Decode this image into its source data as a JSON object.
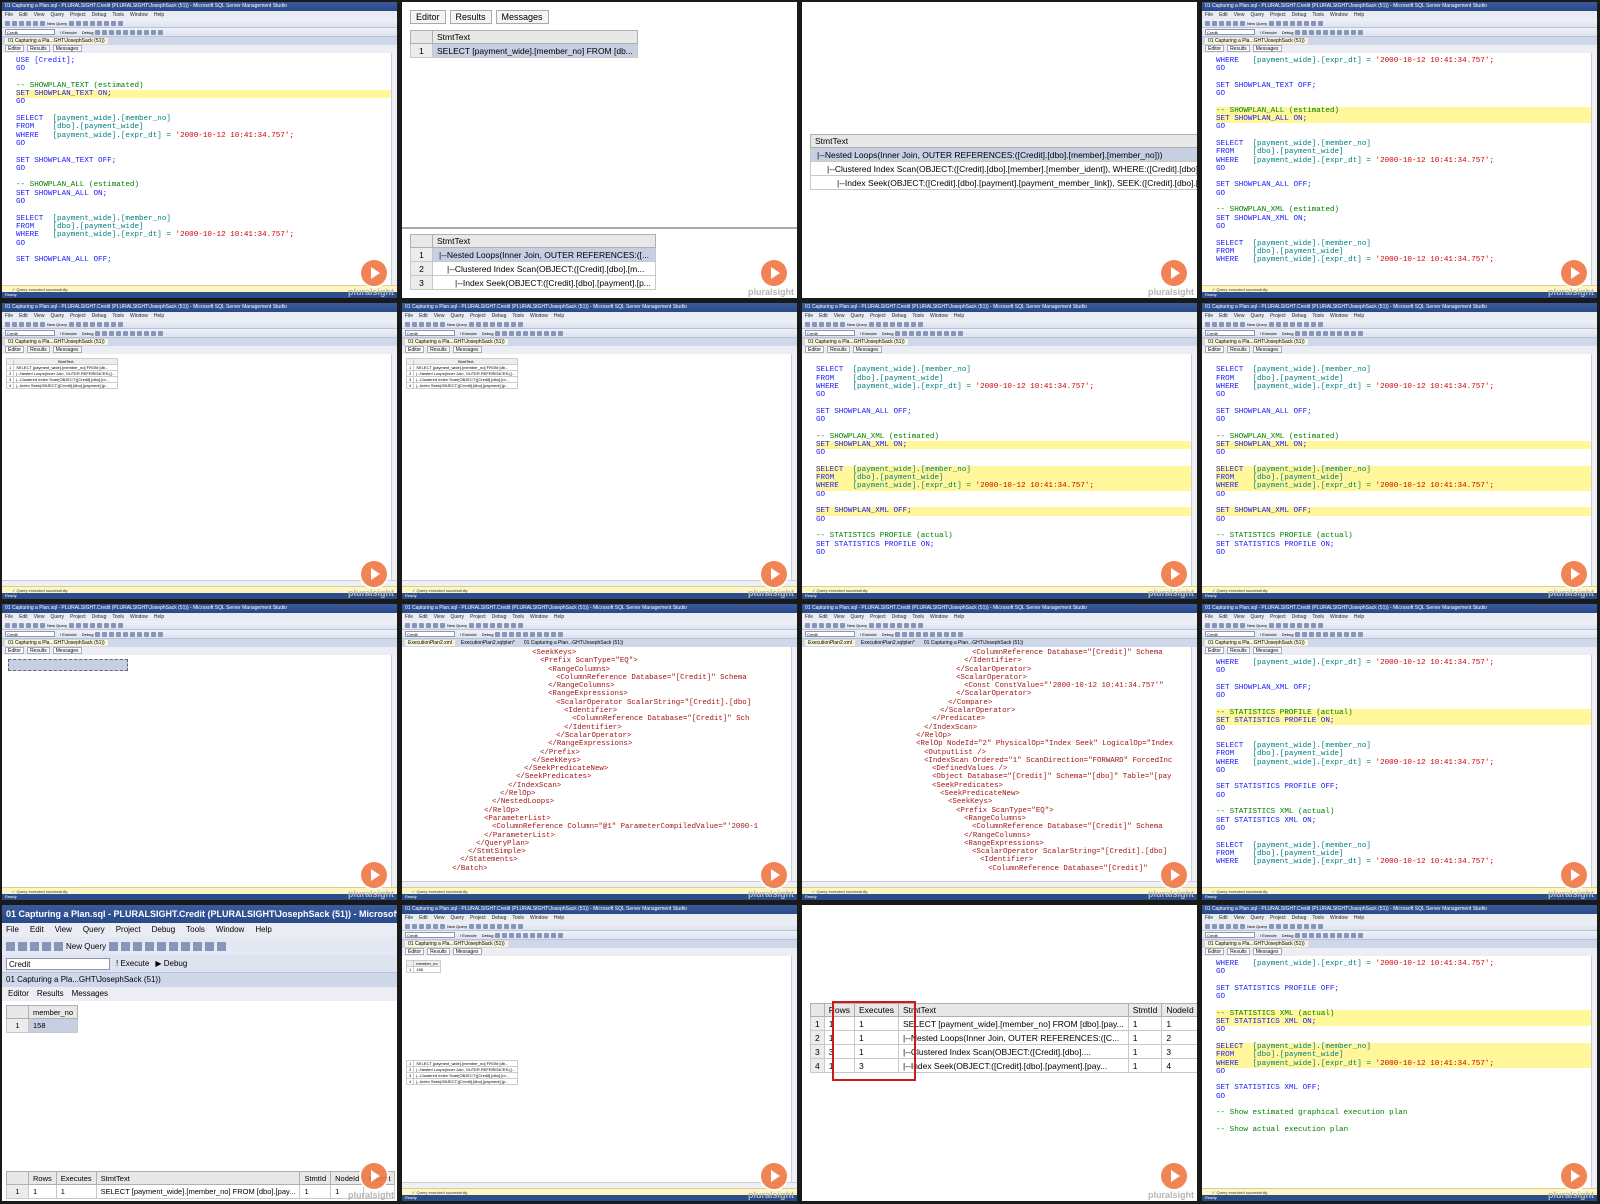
{
  "window": {
    "title": "01 Capturing a Plan.sql - PLURALSIGHT.Credit (PLURALSIGHT\\JosephSack (51)) - Microsoft SQL Server Management Studio",
    "menu": [
      "File",
      "Edit",
      "View",
      "Query",
      "Project",
      "Debug",
      "Tools",
      "Window",
      "Help"
    ],
    "database": "Credit",
    "new_query": "New Query",
    "execute": "Execute",
    "debug": "Debug",
    "doc_tab": "01 Capturing a Pla...GHT\\JosephSack (51))",
    "status": "Query executed successfully.",
    "ready": "Ready",
    "brand": "pluralsight"
  },
  "tabs": {
    "editor": "Editor",
    "results": "Results",
    "messages": "Messages"
  },
  "xml_tabs": [
    "ExecutionPlan2.xml",
    "ExecutionPlan2.sqlplan*",
    "01 Capturing a Plan...GHT\\JosephSack (51))"
  ],
  "results": {
    "stmt_header": "StmtText",
    "select_stmt": "SELECT [payment_wide].[member_no]  FROM   [db...",
    "plan_short": [
      "|--Nested Loops(Inner Join, OUTER REFERENCES:([...",
      "|--Clustered Index Scan(OBJECT:([Credit].[dbo].[m...",
      "|--Index Seek(OBJECT:([Credit].[dbo].[payment].[p..."
    ],
    "plan_long": [
      "|--Nested Loops(Inner Join, OUTER REFERENCES:([Credit].[dbo].[member].[member_no]))",
      "|--Clustered Index Scan(OBJECT:([Credit].[dbo].[member].[member_ident]), WHERE:([Credit].[dbo].[me",
      "|--Index Seek(OBJECT:([Credit].[dbo].[payment].[payment_member_link]), SEEK:([Credit].[dbo].[payme"
    ],
    "member_no_header": "member_no",
    "member_no_value": "158",
    "profile_headers": [
      "Rows",
      "Executes",
      "StmtText",
      "StmtId",
      "NodeId"
    ],
    "profile_rows": [
      [
        "1",
        "1",
        "1",
        "SELECT [payment_wide].[member_no] FROM [dbo].[pay...",
        "1",
        "1"
      ],
      [
        "2",
        "1",
        "1",
        "|--Nested Loops(Inner Join, OUTER REFERENCES:([C...",
        "1",
        "2"
      ],
      [
        "3",
        "3",
        "1",
        "|--Clustered Index Scan(OBJECT:([Credit].[dbo]....",
        "1",
        "3"
      ],
      [
        "4",
        "1",
        "3",
        "|--Index Seek(OBJECT:([Credit].[dbo].[payment].[pay...",
        "1",
        "4"
      ]
    ],
    "profile_row_single": [
      "1",
      "1",
      "1",
      "SELECT [payment_wide].[member_no] FROM [dbo].[pay...",
      "1",
      "1"
    ],
    "profile_headers_short": [
      "Rows",
      "Executes",
      "StmtText",
      "StmtId",
      "NodeId",
      "Parent"
    ]
  },
  "code_lines": {
    "use": "USE [Credit];",
    "go": "GO",
    "c_text": "-- SHOWPLAN_TEXT (estimated)",
    "set_text_on": "SET SHOWPLAN_TEXT ON;",
    "set_text_off": "SET SHOWPLAN_TEXT OFF;",
    "c_all": "-- SHOWPLAN_ALL (estimated)",
    "set_all_on": "SET SHOWPLAN_ALL ON;",
    "set_all_off": "SET SHOWPLAN_ALL OFF;",
    "c_xml": "-- SHOWPLAN_XML (estimated)",
    "set_xml_on": "SET SHOWPLAN_XML ON;",
    "set_xml_off": "SET SHOWPLAN_XML OFF;",
    "c_profile": "-- STATISTICS PROFILE (actual)",
    "set_profile_on": "SET STATISTICS PROFILE ON;",
    "set_profile_off": "SET STATISTICS PROFILE OFF;",
    "c_stxml": "-- STATISTICS XML (actual)",
    "set_stxml_on": "SET STATISTICS XML ON;",
    "set_stxml_off": "SET STATISTICS XML OFF;",
    "select": "SELECT",
    "select_col": "[payment_wide].[member_no]",
    "from": "FROM",
    "from_obj": "[dbo].[payment_wide]",
    "where": "WHERE",
    "where_col": "[payment_wide].[expr_dt] =",
    "where_val": "'2000-10-12 10:41:34.757';",
    "c_graph_est": "-- Show estimated graphical execution plan",
    "c_graph_act": "-- Show actual execution plan"
  },
  "xml1": [
    "<SeekKeys>",
    "<Prefix ScanType=\"EQ\">",
    "<RangeColumns>",
    "<ColumnReference Database=\"[Credit]\" Schema",
    "</RangeColumns>",
    "<RangeExpressions>",
    "<ScalarOperator ScalarString=\"[Credit].[dbo]",
    "<Identifier>",
    "<ColumnReference Database=\"[Credit]\" Sch",
    "</Identifier>",
    "</ScalarOperator>",
    "</RangeExpressions>",
    "</Prefix>",
    "</SeekKeys>",
    "</SeekPredicateNew>",
    "</SeekPredicates>",
    "</IndexScan>",
    "</RelOp>",
    "</NestedLoops>",
    "</RelOp>",
    "<ParameterList>",
    "<ColumnReference Column=\"@1\" ParameterCompiledValue=\"'2000-1",
    "</ParameterList>",
    "</QueryPlan>",
    "</StmtSimple>",
    "</Statements>",
    "</Batch>"
  ],
  "xml2": [
    "<ColumnReference Database=\"[Credit]\" Schema",
    "</Identifier>",
    "</ScalarOperator>",
    "<ScalarOperator>",
    "<Const ConstValue=\"'2000-10-12 10:41:34.757'\"",
    "</ScalarOperator>",
    "</Compare>",
    "</ScalarOperator>",
    "</Predicate>",
    "</IndexScan>",
    "</RelOp>",
    "<RelOp NodeId=\"2\" PhysicalOp=\"Index Seek\" LogicalOp=\"Index",
    "<OutputList />",
    "<IndexScan Ordered=\"1\" ScanDirection=\"FORWARD\" ForcedInc",
    "<DefinedValues />",
    "<Object Database=\"[Credit]\" Schema=\"[dbo]\" Table=\"[pay",
    "<SeekPredicates>",
    "<SeekPredicateNew>",
    "<SeekKeys>",
    "<Prefix ScanType=\"EQ\">",
    "<RangeColumns>",
    "<ColumnReference Database=\"[Credit]\" Schema",
    "</RangeColumns>",
    "<RangeExpressions>",
    "<ScalarOperator ScalarString=\"[Credit].[dbo]",
    "<Identifier>",
    "<ColumnReference Database=\"[Credit]\""
  ]
}
